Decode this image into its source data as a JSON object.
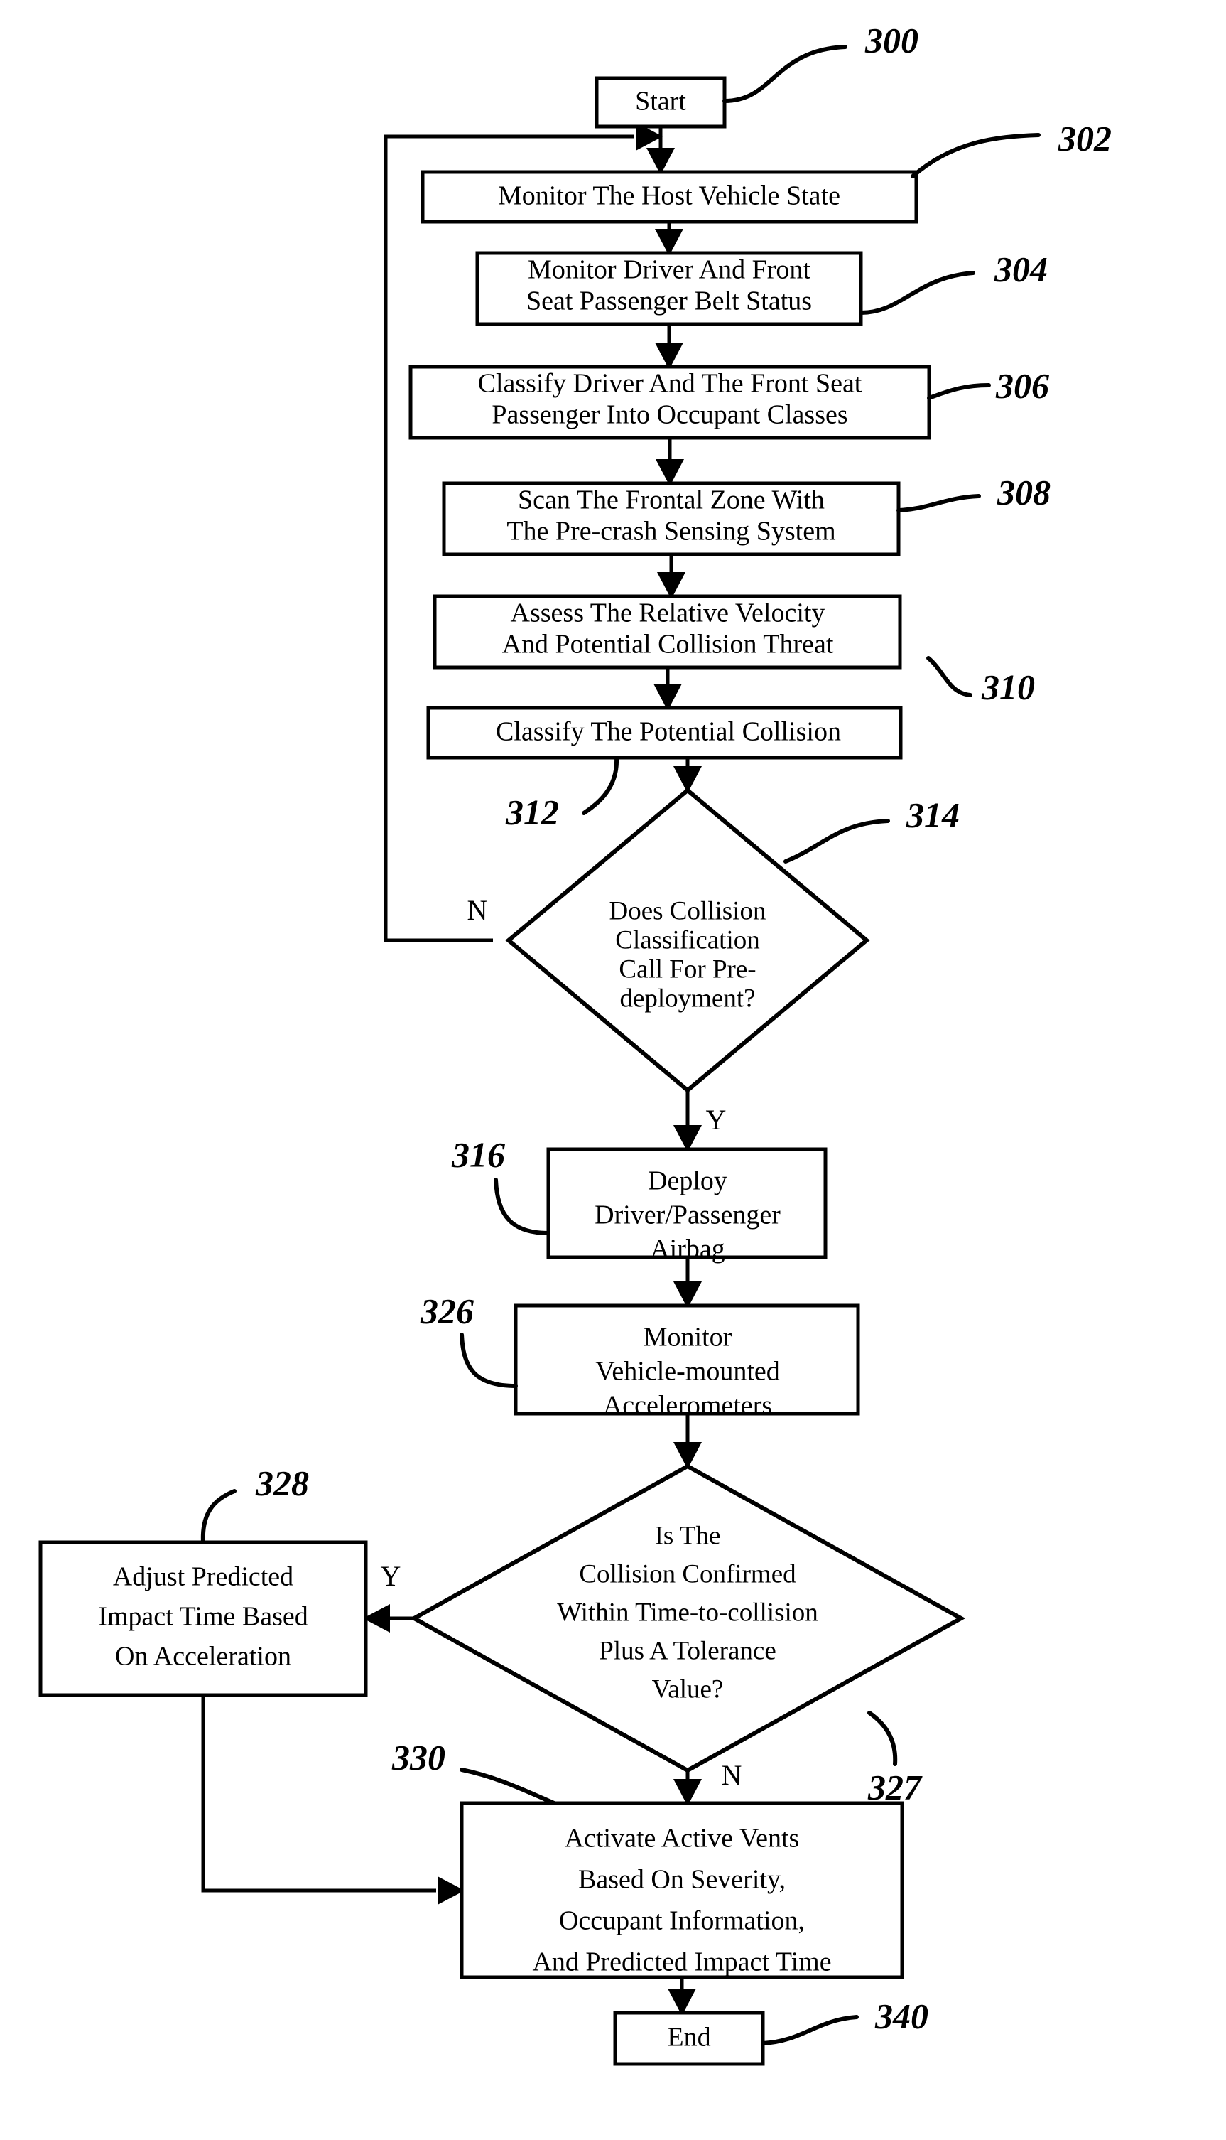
{
  "figure": {
    "type": "patent-flowchart",
    "background_color": "#ffffff",
    "line_color": "#000000"
  },
  "nodes": {
    "start": {
      "label": "Start",
      "ref": "300",
      "shape": "rect"
    },
    "n302": {
      "label": "Monitor The Host Vehicle State",
      "ref": "302",
      "shape": "rect"
    },
    "n304_l1": {
      "label": "Monitor Driver And Front",
      "ref": "304",
      "shape": "rect"
    },
    "n304_l2": {
      "label": "Seat Passenger Belt Status"
    },
    "n306_l1": {
      "label": "Classify Driver And The Front Seat",
      "ref": "306",
      "shape": "rect"
    },
    "n306_l2": {
      "label": "Passenger Into Occupant Classes"
    },
    "n308_l1": {
      "label": "Scan The Frontal Zone With",
      "ref": "308",
      "shape": "rect"
    },
    "n308_l2": {
      "label": "The Pre-crash Sensing System"
    },
    "n310_l1": {
      "label": "Assess The Relative Velocity",
      "ref": "310",
      "shape": "rect"
    },
    "n310_l2": {
      "label": "And Potential Collision Threat"
    },
    "n312": {
      "label": "Classify The Potential Collision",
      "ref": "312",
      "shape": "rect"
    },
    "n314_l1": {
      "label": "Does Collision",
      "ref": "314",
      "shape": "diamond"
    },
    "n314_l2": {
      "label": "Classification"
    },
    "n314_l3": {
      "label": "Call For Pre-"
    },
    "n314_l4": {
      "label": "deployment?"
    },
    "n316_l1": {
      "label": "Deploy",
      "ref": "316",
      "shape": "rect"
    },
    "n316_l2": {
      "label": "Driver/Passenger"
    },
    "n316_l3": {
      "label": "Airbag"
    },
    "n326_l1": {
      "label": "Monitor",
      "ref": "326",
      "shape": "rect"
    },
    "n326_l2": {
      "label": "Vehicle-mounted"
    },
    "n326_l3": {
      "label": "Accelerometers"
    },
    "n327_l1": {
      "label": "Is The",
      "ref": "327",
      "shape": "diamond"
    },
    "n327_l2": {
      "label": "Collision Confirmed"
    },
    "n327_l3": {
      "label": "Within Time-to-collision"
    },
    "n327_l4": {
      "label": "Plus A Tolerance"
    },
    "n327_l5": {
      "label": "Value?"
    },
    "n328_l1": {
      "label": "Adjust Predicted",
      "ref": "328",
      "shape": "rect"
    },
    "n328_l2": {
      "label": "Impact Time Based"
    },
    "n328_l3": {
      "label": "On Acceleration"
    },
    "n330_l1": {
      "label": "Activate Active Vents",
      "ref": "330",
      "shape": "rect"
    },
    "n330_l2": {
      "label": "Based On Severity,"
    },
    "n330_l3": {
      "label": "Occupant Information,"
    },
    "n330_l4": {
      "label": "And Predicted Impact Time"
    },
    "end": {
      "label": "End",
      "ref": "340",
      "shape": "rect"
    }
  },
  "branch_labels": {
    "d314_no": "N",
    "d314_yes": "Y",
    "d327_yes": "Y",
    "d327_no": "N"
  },
  "reference_numerals": {
    "r300": "300",
    "r302": "302",
    "r304": "304",
    "r306": "306",
    "r308": "308",
    "r310": "310",
    "r312": "312",
    "r314": "314",
    "r316": "316",
    "r326": "326",
    "r327": "327",
    "r328": "328",
    "r330": "330",
    "r340": "340"
  }
}
